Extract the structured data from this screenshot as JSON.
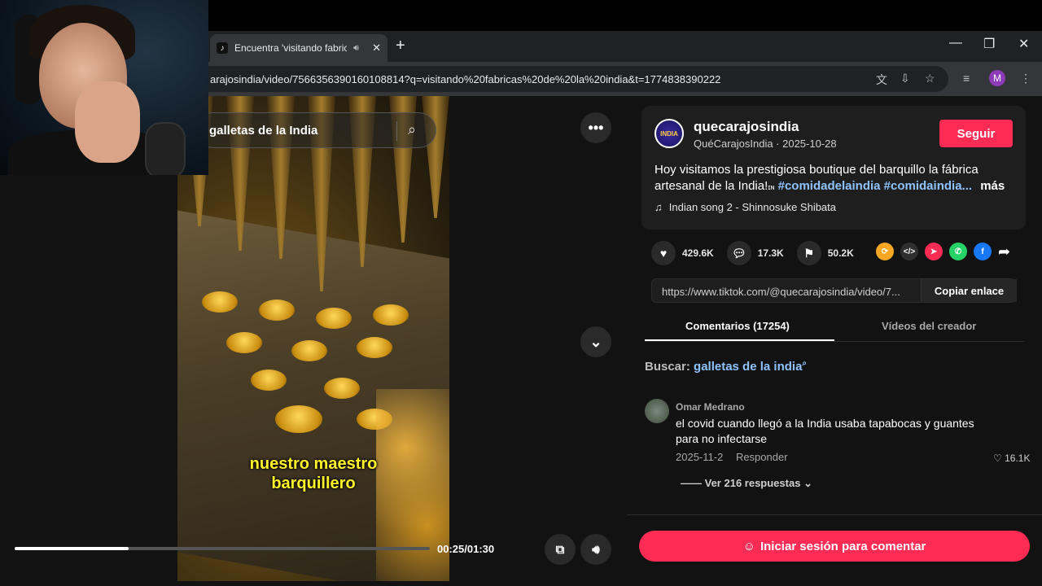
{
  "browser": {
    "tab_title": "Encuentra 'visitando fabrica",
    "url": "arajosindia/video/7566356390160108814?q=visitando%20fabricas%20de%20la%20india&t=1774838390222",
    "profile_initial": "M"
  },
  "video": {
    "search_text": "galletas de la India",
    "caption_line1": "nuestro maestro",
    "caption_line2": "barquillero",
    "time": "00:25/01:30",
    "progress": 0.275
  },
  "post": {
    "logo_text": "INDIA",
    "username": "quecarajosindia",
    "nickname_date": "QuéCarajosIndia · 2025-10-28",
    "follow_label": "Seguir",
    "description_text": "Hoy visitamos la prestigiosa boutique del barquillo la fábrica artesanal de la India!",
    "description_flag": "ɪɴ",
    "hashtag1": "#comidadelaindia",
    "hashtag2": "#comidaindia...",
    "more_label": "más",
    "music": "Indian song 2 - Shinnosuke Shibata"
  },
  "stats": {
    "likes": "429.6K",
    "comments": "17.3K",
    "saves": "50.2K"
  },
  "share": {
    "link": "https://www.tiktok.com/@quecarajosindia/video/7...",
    "copy_label": "Copiar enlace"
  },
  "tabs": {
    "comments": "Comentarios (17254)",
    "creator_videos": "Vídeos del creador"
  },
  "search_suggest": {
    "label": "Buscar:",
    "query": "galletas de la india"
  },
  "comment": {
    "author": "Omar Medrano",
    "text": "el covid cuando llegó a la India usaba tapabocas y guantes para no infectarse",
    "date": "2025-11-2",
    "reply_label": "Responder",
    "likes": "16.1K",
    "replies_label": "Ver 216 respuestas"
  },
  "login_label": "Iniciar sesión para comentar",
  "colors": {
    "accent": "#fe2c55",
    "hashtag": "#8fc3ff",
    "caption": "#fff32a"
  }
}
